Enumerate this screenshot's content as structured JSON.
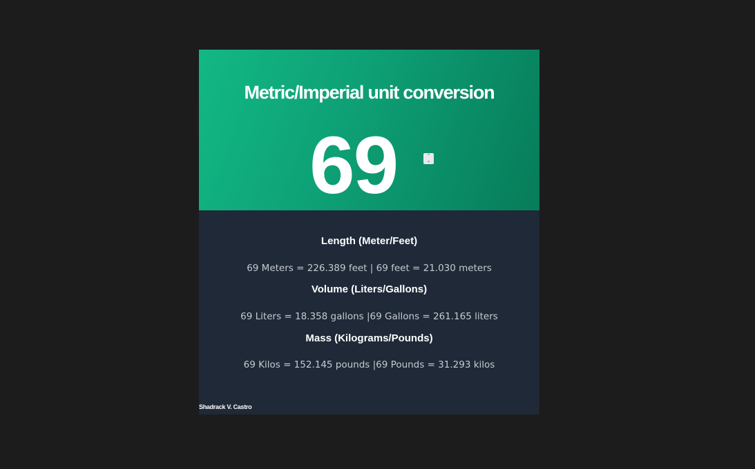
{
  "header": {
    "title": "Metric/Imperial unit conversion",
    "input_value": "69"
  },
  "sections": [
    {
      "heading": "Length (Meter/Feet)",
      "text": "69 Meters = 226.389 feet | 69 feet = 21.030 meters"
    },
    {
      "heading": "Volume (Liters/Gallons)",
      "text": "69 Liters = 18.358 gallons |69 Gallons = 261.165 liters"
    },
    {
      "heading": "Mass (Kilograms/Pounds)",
      "text": "69 Kilos = 152.145 pounds |69 Pounds = 31.293 kilos"
    }
  ],
  "footer": {
    "author": "Shadrack V. Castro"
  },
  "colors": {
    "page_background": "#1c1c1c",
    "gradient_start": "#12b884",
    "gradient_end": "#077c59",
    "card_background": "#1f2937",
    "heading_text": "#ffffff",
    "body_text": "#c6cbd2"
  },
  "icons": {
    "spinner": "number-spinner-icon"
  }
}
